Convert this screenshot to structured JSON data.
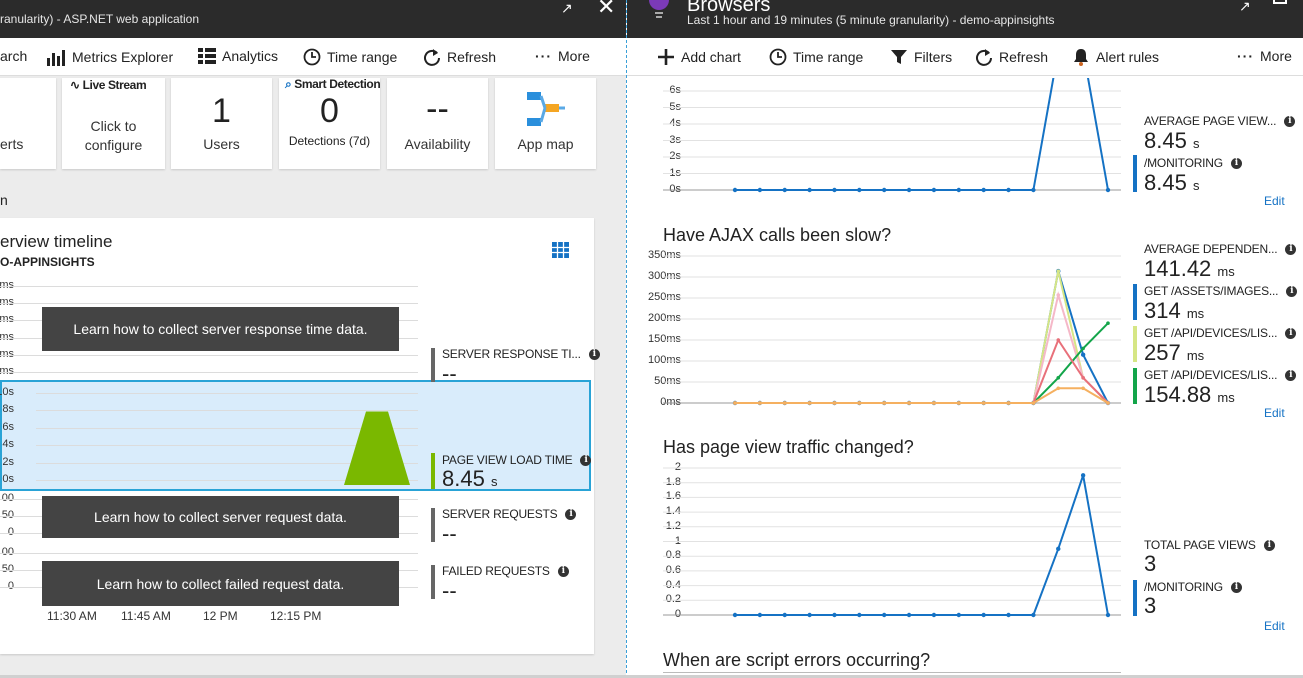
{
  "left_blade": {
    "subtitle": "ranularity) - ASP.NET web application",
    "toolbar": {
      "search_partial": "arch",
      "metrics_explorer": "Metrics Explorer",
      "analytics": "Analytics",
      "time_range": "Time range",
      "refresh": "Refresh",
      "more": "More"
    },
    "tiles": {
      "alerts_partial": "erts",
      "live_stream_title": "Live Stream",
      "live_stream_line1": "Click to",
      "live_stream_line2": "configure",
      "users_value": "1",
      "users_label": "Users",
      "smart_title": "Smart Detection",
      "smart_value": "0",
      "smart_label": "Detections (7d)",
      "availability_value": "--",
      "availability_label": "Availability",
      "appmap_label": "App map"
    },
    "section_partial": "n",
    "timeline": {
      "title": "erview timeline",
      "subtitle": "O-APPINSIGHTS",
      "srv_ticks": [
        "ms",
        "ms",
        "ms",
        "ms",
        "ms",
        "ms"
      ],
      "srv_overlay": "Learn how to collect server response time data.",
      "plt_ticks": [
        "10s",
        "8s",
        "6s",
        "4s",
        "2s",
        "0s"
      ],
      "req_ticks": [
        "00",
        "50",
        "0"
      ],
      "req_overlay": "Learn how to collect server request data.",
      "fail_ticks": [
        "00",
        "50",
        "0"
      ],
      "fail_overlay": "Learn how to collect failed request data.",
      "x_ticks": [
        "11:30 AM",
        "11:45 AM",
        "12 PM",
        "12:15 PM"
      ],
      "metrics": {
        "server_response": "SERVER RESPONSE TI...",
        "server_response_value": "--",
        "page_view": "PAGE VIEW LOAD TIME",
        "page_view_value": "8.45",
        "page_view_unit": "s",
        "server_requests": "SERVER REQUESTS",
        "server_requests_value": "--",
        "failed_requests": "FAILED REQUESTS",
        "failed_requests_value": "--"
      }
    }
  },
  "right_blade": {
    "title": "Browsers",
    "subtitle": "Last 1 hour and 19 minutes (5 minute granularity) - demo-appinsights",
    "toolbar": {
      "add_chart": "Add chart",
      "time_range": "Time range",
      "filters": "Filters",
      "refresh": "Refresh",
      "alert_rules": "Alert rules",
      "more": "More"
    },
    "edit": "Edit",
    "chart1": {
      "ticks": [
        "6s",
        "5s",
        "4s",
        "3s",
        "2s",
        "1s",
        "0s"
      ],
      "m1_name": "AVERAGE PAGE VIEW...",
      "m1_value": "8.45",
      "m1_unit": "s",
      "m2_name": "/MONITORING",
      "m2_value": "8.45",
      "m2_unit": "s"
    },
    "chart2": {
      "title": "Have AJAX calls been slow?",
      "ticks": [
        "350ms",
        "300ms",
        "250ms",
        "200ms",
        "150ms",
        "100ms",
        "50ms",
        "0ms"
      ],
      "m1_name": "AVERAGE DEPENDEN...",
      "m1_value": "141.42",
      "m1_unit": "ms",
      "m2_name": "GET /ASSETS/IMAGES...",
      "m2_value": "314",
      "m2_unit": "ms",
      "m3_name": "GET /API/DEVICES/LIS...",
      "m3_value": "257",
      "m3_unit": "ms",
      "m4_name": "GET /API/DEVICES/LIS...",
      "m4_value": "154.88",
      "m4_unit": "ms"
    },
    "chart3": {
      "title": "Has page view traffic changed?",
      "ticks": [
        "2",
        "1.8",
        "1.6",
        "1.4",
        "1.2",
        "1",
        "0.8",
        "0.6",
        "0.4",
        "0.2",
        "0"
      ],
      "m1_name": "TOTAL PAGE VIEWS",
      "m1_value": "3",
      "m2_name": "/MONITORING",
      "m2_value": "3"
    },
    "chart4": {
      "title": "When are script errors occurring?"
    }
  },
  "colors": {
    "titlebar": "#2b2b2b",
    "blue": "#1572c4",
    "green": "#7ab800",
    "selection": "#d9ecfb",
    "selection_border": "#29a3d6"
  },
  "chart_data": [
    {
      "type": "area",
      "series": [
        {
          "name": "PAGE VIEW LOAD TIME",
          "values": [
            0,
            0,
            0,
            0,
            0,
            0,
            0,
            0,
            0,
            0,
            0,
            0,
            0,
            0,
            0,
            8.45,
            8.45,
            0
          ]
        }
      ],
      "ylim": [
        0,
        10
      ]
    },
    {
      "type": "line",
      "series": [
        {
          "name": "AVERAGE PAGE VIEW...",
          "values": [
            0,
            0,
            0,
            0,
            0,
            0,
            0,
            0,
            0,
            0,
            0,
            0,
            0,
            8.45,
            8.45,
            0
          ]
        }
      ],
      "ylim": [
        0,
        6
      ]
    },
    {
      "type": "line",
      "series": [
        {
          "name": "AVERAGE DEPENDEN...",
          "values": [
            0,
            0,
            0,
            0,
            0,
            0,
            0,
            0,
            0,
            0,
            0,
            0,
            0,
            314,
            115,
            0
          ]
        },
        {
          "name": "GET /ASSETS/IMAGES...",
          "values": [
            0,
            0,
            0,
            0,
            0,
            0,
            0,
            0,
            0,
            0,
            0,
            0,
            0,
            314,
            60,
            0
          ]
        },
        {
          "name": "GET /API/DEVICES/LIS...",
          "values": [
            0,
            0,
            0,
            0,
            0,
            0,
            0,
            0,
            0,
            0,
            0,
            0,
            0,
            257,
            60,
            0
          ]
        },
        {
          "name": "GET /API/DEVICES/LIS...",
          "values": [
            0,
            0,
            0,
            0,
            0,
            0,
            0,
            0,
            0,
            0,
            0,
            0,
            0,
            60,
            130,
            190
          ]
        },
        {
          "name": "",
          "values": [
            0,
            0,
            0,
            0,
            0,
            0,
            0,
            0,
            0,
            0,
            0,
            0,
            0,
            150,
            60,
            0
          ]
        },
        {
          "name": "",
          "values": [
            0,
            0,
            0,
            0,
            0,
            0,
            0,
            0,
            0,
            0,
            0,
            0,
            0,
            35,
            35,
            0
          ]
        }
      ],
      "ylim": [
        0,
        350
      ]
    },
    {
      "type": "line",
      "series": [
        {
          "name": "TOTAL PAGE VIEWS",
          "values": [
            0,
            0,
            0,
            0,
            0,
            0,
            0,
            0,
            0,
            0,
            0,
            0,
            0,
            0.9,
            1.9,
            0
          ]
        }
      ],
      "ylim": [
        0,
        2
      ]
    }
  ]
}
